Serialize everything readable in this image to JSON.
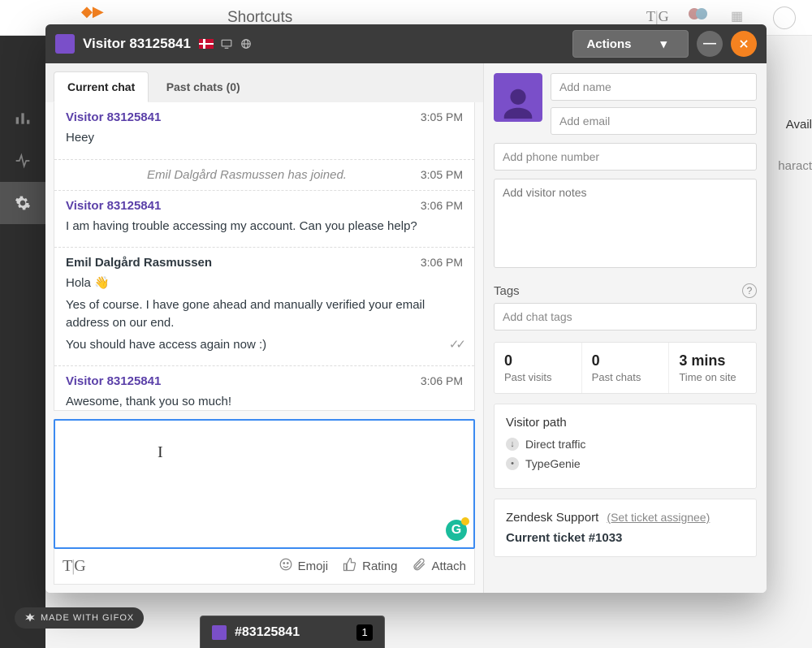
{
  "bg": {
    "page_label": "Shortcuts",
    "right1": "Avail",
    "right2": "haract"
  },
  "header": {
    "visitor_name": "Visitor 83125841",
    "actions_label": "Actions"
  },
  "tabs": {
    "current": "Current chat",
    "past": "Past chats (0)"
  },
  "messages": [
    {
      "type": "visitor",
      "sender": "Visitor 83125841",
      "time": "3:05 PM",
      "lines": [
        "Heey"
      ]
    },
    {
      "type": "system",
      "text": "Emil Dalgård Rasmussen has joined.",
      "time": "3:05 PM"
    },
    {
      "type": "visitor",
      "sender": "Visitor 83125841",
      "time": "3:06 PM",
      "lines": [
        "I am having trouble accessing my account. Can you please help?"
      ]
    },
    {
      "type": "agent",
      "sender": "Emil Dalgård Rasmussen",
      "time": "3:06 PM",
      "lines": [
        "Hola 👋",
        "Yes of course. I have gone ahead and manually verified your email address on our end.",
        "You should have access again now :)"
      ],
      "delivered": true
    },
    {
      "type": "visitor",
      "sender": "Visitor 83125841",
      "time": "3:06 PM",
      "lines": [
        "Awesome, thank you so much!"
      ]
    }
  ],
  "compose": {
    "tg_brand": "T|G",
    "emoji": "Emoji",
    "rating": "Rating",
    "attach": "Attach"
  },
  "profile": {
    "name_ph": "Add name",
    "email_ph": "Add email",
    "phone_ph": "Add phone number",
    "notes_ph": "Add visitor notes"
  },
  "tags": {
    "heading": "Tags",
    "input_ph": "Add chat tags"
  },
  "stats": {
    "visits_val": "0",
    "visits_label": "Past visits",
    "chats_val": "0",
    "chats_label": "Past chats",
    "time_val": "3 mins",
    "time_label": "Time on site"
  },
  "path": {
    "title": "Visitor path",
    "items": [
      "Direct traffic",
      "TypeGenie"
    ]
  },
  "zendesk": {
    "heading": "Zendesk Support",
    "assignee_link": "(Set ticket assignee)",
    "ticket_label": "Current ticket #1033"
  },
  "footer_tab": {
    "label": "#83125841",
    "badge": "1"
  },
  "gifox": "MADE WITH GIFOX"
}
